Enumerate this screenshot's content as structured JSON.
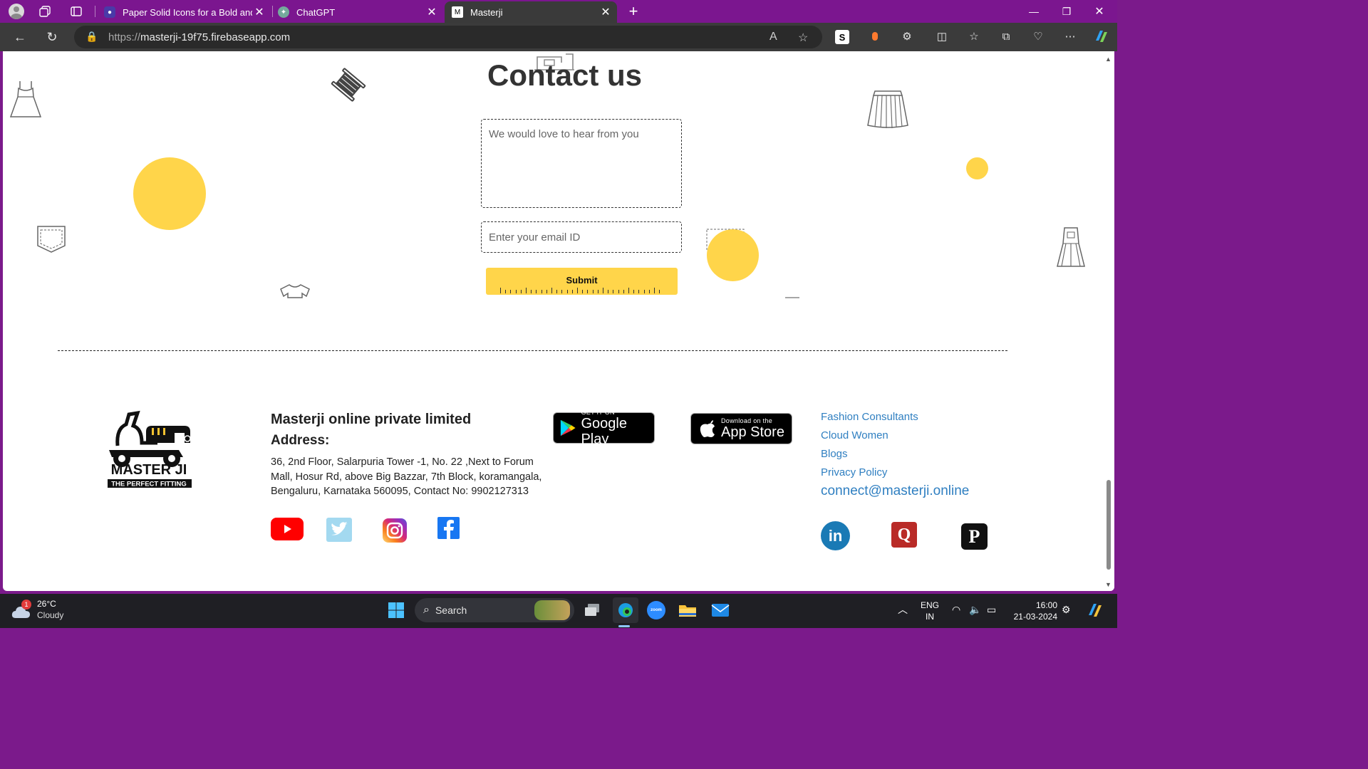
{
  "browser": {
    "tabs": [
      {
        "title": "Paper Solid Icons for a Bold and",
        "active": false
      },
      {
        "title": "ChatGPT",
        "active": false
      },
      {
        "title": "Masterji",
        "active": true
      }
    ],
    "url_scheme": "https://",
    "url_host": "masterji-19f75.firebaseapp.com"
  },
  "contact": {
    "title": "Contact us",
    "message_placeholder": "We would love to hear from you",
    "email_placeholder": "Enter your email ID",
    "submit_label": "Submit"
  },
  "footer": {
    "logo_text": "MASTER JI",
    "logo_tagline": "THE PERFECT FITTING",
    "company": "Masterji online private limited",
    "address_label": "Address:",
    "address": "36, 2nd Floor, Salarpuria Tower -1, No. 22 ,Next to Forum Mall, Hosur Rd, above Big Bazzar, 7th Block, koramangala, Bengaluru, Karnataka 560095, Contact No: 9902127313",
    "google_play": {
      "small": "GET IT ON",
      "big": "Google Play"
    },
    "app_store": {
      "small": "Download on the",
      "big": "App Store"
    },
    "links": [
      "Fashion Consultants",
      "Cloud Women",
      "Blogs",
      "Privacy Policy"
    ],
    "email": "connect@masterji.online",
    "social_left": [
      "youtube-icon",
      "twitter-icon",
      "instagram-icon",
      "facebook-icon"
    ],
    "social_right": [
      "linkedin-icon",
      "quora-icon",
      "pinterest-icon"
    ]
  },
  "colors": {
    "accent_yellow": "#ffd54a",
    "link_blue": "#2f7fc1",
    "browser_purple": "#7b168f"
  },
  "taskbar": {
    "weather_temp": "26°C",
    "weather_desc": "Cloudy",
    "weather_badge": "1",
    "search_label": "Search",
    "lang_top": "ENG",
    "lang_bottom": "IN",
    "time": "16:00",
    "date": "21-03-2024"
  }
}
